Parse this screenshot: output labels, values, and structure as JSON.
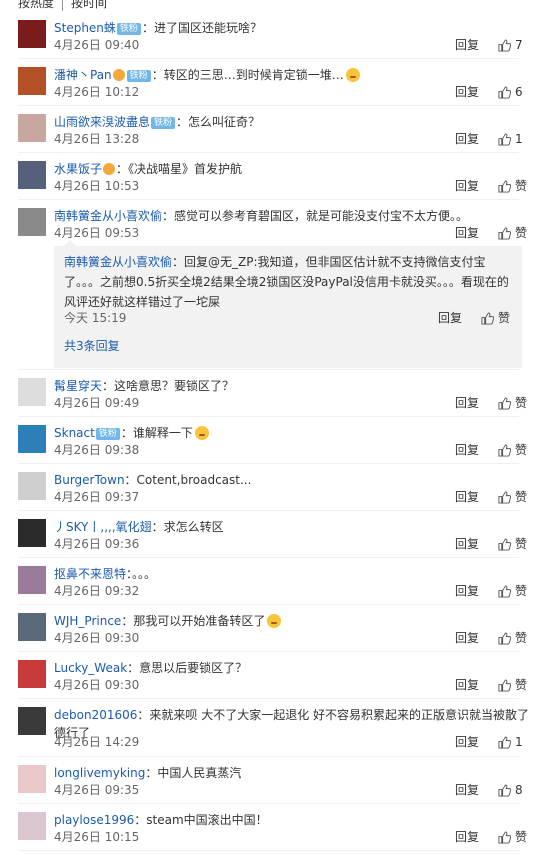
{
  "tabs": [
    "按热度",
    "按时间"
  ],
  "comments": [
    {
      "user": "Stephen蛛",
      "badge": "铁粉",
      "vip": false,
      "text": "：进了国区还能玩啥？",
      "time": "4月26日 09:40",
      "reply": "回复",
      "likes": "7",
      "avatar_color": "#7a1c1c"
    },
    {
      "user": "潘神丶Pan",
      "badge": "铁粉",
      "vip": true,
      "text": "：转区的三思…到时候肯定锁一堆…",
      "emoji": true,
      "time": "4月26日 10:12",
      "reply": "回复",
      "likes": "6",
      "avatar_color": "#b45028"
    },
    {
      "user": "山雨欲来湨波盡息",
      "badge": "铁粉",
      "vip": false,
      "text": "：怎么叫征奇？",
      "time": "4月26日 13:28",
      "reply": "回复",
      "likes": "1",
      "avatar_color": "#c7a6a0"
    },
    {
      "user": "水果饭子",
      "badge": "",
      "vip": true,
      "text": "：《决战喵星》首发护航",
      "time": "4月26日 10:53",
      "reply": "回复",
      "likes": "赞",
      "avatar_color": "#55607a"
    },
    {
      "user": "南韩黉金从小喜欢偷",
      "badge": "",
      "vip": false,
      "text": "：感觉可以参考育碧国区，就是可能没支付宝不太方便。。",
      "time": "4月26日 09:53",
      "reply": "回复",
      "likes": "赞",
      "avatar_color": "#8a8a8a"
    },
    {
      "user": "髯星穿天",
      "badge": "",
      "vip": false,
      "text": "：这啥意思？要锁区了？",
      "time": "4月26日 09:49",
      "reply": "回复",
      "likes": "赞",
      "avatar_color": "#dddddd"
    },
    {
      "user": "Sknact",
      "badge": "铁粉",
      "vip": false,
      "text": "：谁解释一下",
      "emoji": true,
      "time": "4月26日 09:38",
      "reply": "回复",
      "likes": "赞",
      "avatar_color": "#2d7fb8"
    },
    {
      "user": "BurgerTown",
      "badge": "",
      "vip": false,
      "text": "：Cotent,broadcast...",
      "time": "4月26日 09:37",
      "reply": "回复",
      "likes": "赞",
      "avatar_color": "#cfcfcf"
    },
    {
      "user": "丿SKY丨,,,,氧化翅",
      "badge": "",
      "vip": false,
      "text": "：求怎么转区",
      "time": "4月26日 09:36",
      "reply": "回复",
      "likes": "赞",
      "avatar_color": "#2b2b2b"
    },
    {
      "user": "抠鼻不来恩特",
      "badge": "",
      "vip": false,
      "text": "：。。。",
      "time": "4月26日 09:32",
      "reply": "回复",
      "likes": "赞",
      "avatar_color": "#9a7a9a"
    },
    {
      "user": "WJH_Prince",
      "badge": "",
      "vip": false,
      "text": "：那我可以开始准备转区了",
      "emoji": true,
      "time": "4月26日 09:30",
      "reply": "回复",
      "likes": "赞",
      "avatar_color": "#5a6a7a"
    },
    {
      "user": "Lucky_Weak",
      "badge": "",
      "vip": false,
      "text": "：意思以后要锁区了？",
      "time": "4月26日 09:30",
      "reply": "回复",
      "likes": "赞",
      "avatar_color": "#c83a3a"
    },
    {
      "user": "debon201606",
      "badge": "",
      "vip": false,
      "text": "：来就来呗 大不了大家一起退化 好不容易积累起来的正版意识就当被散了",
      "text2": "德行了",
      "time": "4月26日 14:29",
      "reply": "回复",
      "likes": "1",
      "avatar_color": "#3a3a3a"
    },
    {
      "user": "longlivemyking",
      "badge": "",
      "vip": false,
      "text": "：中国人民真蒸汽",
      "time": "4月26日 09:35",
      "reply": "回复",
      "likes": "8",
      "avatar_color": "#e7c9c9"
    },
    {
      "user": "playlose1996",
      "badge": "",
      "vip": false,
      "text": "：steam中国滚出中国！",
      "time": "4月26日 10:15",
      "reply": "回复",
      "likes": "赞",
      "avatar_color": "#d9c6d0"
    }
  ],
  "subreply": {
    "user": "南韩黉金从小喜欢偷",
    "text": "：回复@无_ZP:我知道，但非国区估计就不支持微信支付宝了。。。之前想0.5折买全境2结果全境2锁国区没PayPal没信用卡就没买。。。看现在的风评还好就这样错过了一坨屎",
    "mention": "@无_ZP",
    "time": "今天 15:19",
    "reply": "回复",
    "likes": "赞",
    "more": "共3条回复"
  }
}
